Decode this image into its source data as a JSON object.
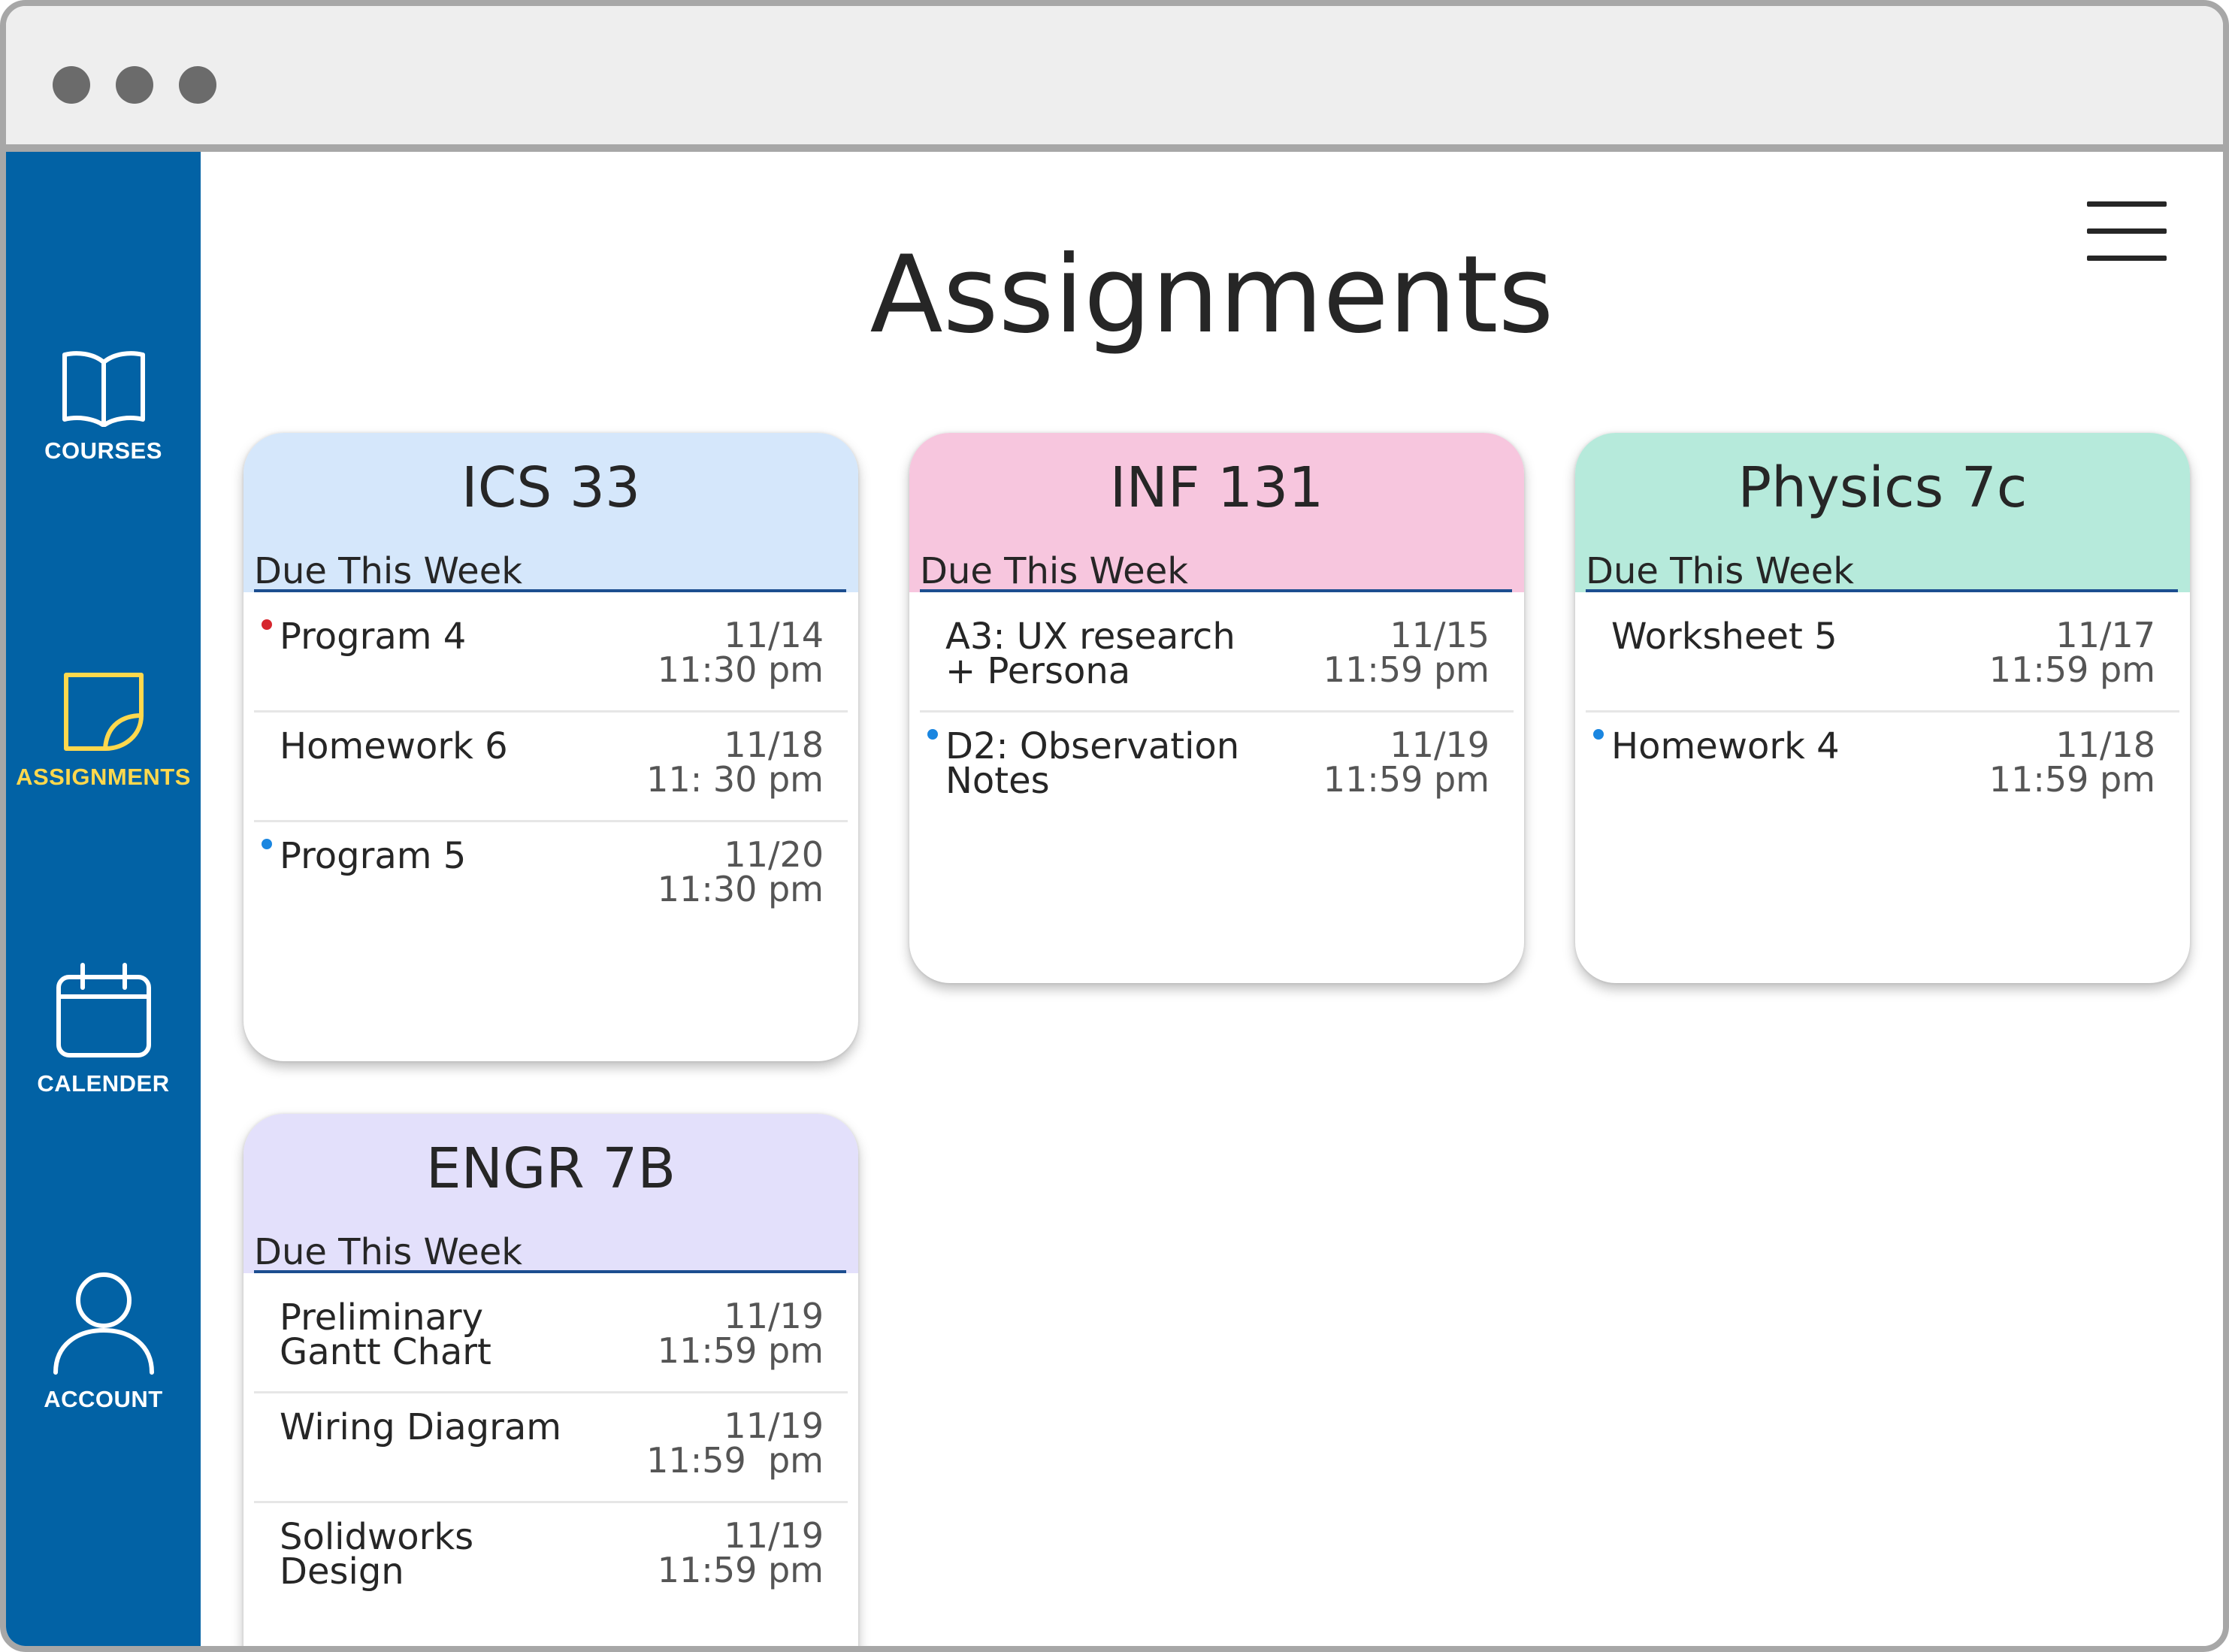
{
  "sidebar": {
    "items": [
      {
        "label": "COURSES",
        "icon": "book-open-icon",
        "active": false
      },
      {
        "label": "ASSIGNMENTS",
        "icon": "sticky-note-icon",
        "active": true
      },
      {
        "label": "CALENDER",
        "icon": "calendar-icon",
        "active": false
      },
      {
        "label": "ACCOUNT",
        "icon": "user-icon",
        "active": false
      }
    ]
  },
  "header": {
    "title": "Assignments",
    "menu_icon": "hamburger-menu-icon"
  },
  "colors": {
    "sidebar_bg": "#0262a5",
    "active_nav": "#ffd84d",
    "marker_red": "#d6262e",
    "marker_blue": "#1a86e0"
  },
  "courses": [
    {
      "title": "ICS 33",
      "header_color": "#d5e7fb",
      "due_label": "Due This Week",
      "assignments": [
        {
          "name": "Program 4",
          "date": "11/14",
          "time": "11:30 pm",
          "marker": "red"
        },
        {
          "name": "Homework 6",
          "date": "11/18",
          "time": "11: 30 pm",
          "marker": "none"
        },
        {
          "name": "Program 5",
          "date": "11/20",
          "time": "11:30 pm",
          "marker": "blue"
        }
      ]
    },
    {
      "title": "INF 131",
      "header_color": "#f7c6de",
      "due_label": "Due This Week",
      "assignments": [
        {
          "name": "A3: UX research + Persona",
          "date": "11/15",
          "time": "11:59 pm",
          "marker": "none"
        },
        {
          "name": "D2: Observation Notes",
          "date": "11/19",
          "time": "11:59 pm",
          "marker": "blue"
        }
      ]
    },
    {
      "title": "Physics 7c",
      "header_color": "#b6eadb",
      "due_label": "Due This Week",
      "assignments": [
        {
          "name": "Worksheet 5",
          "date": "11/17",
          "time": "11:59 pm",
          "marker": "none"
        },
        {
          "name": "Homework 4",
          "date": "11/18",
          "time": "11:59 pm",
          "marker": "blue"
        }
      ]
    },
    {
      "title": "ENGR 7B",
      "header_color": "#e3e0fb",
      "due_label": "Due This Week",
      "assignments": [
        {
          "name": "Preliminary Gantt Chart",
          "date": "11/19",
          "time": "11:59 pm",
          "marker": "none"
        },
        {
          "name": "Wiring Diagram",
          "date": "11/19",
          "time": "11:59  pm",
          "marker": "none"
        },
        {
          "name": "Solidworks Design",
          "date": "11/19",
          "time": "11:59 pm",
          "marker": "none"
        }
      ]
    }
  ]
}
